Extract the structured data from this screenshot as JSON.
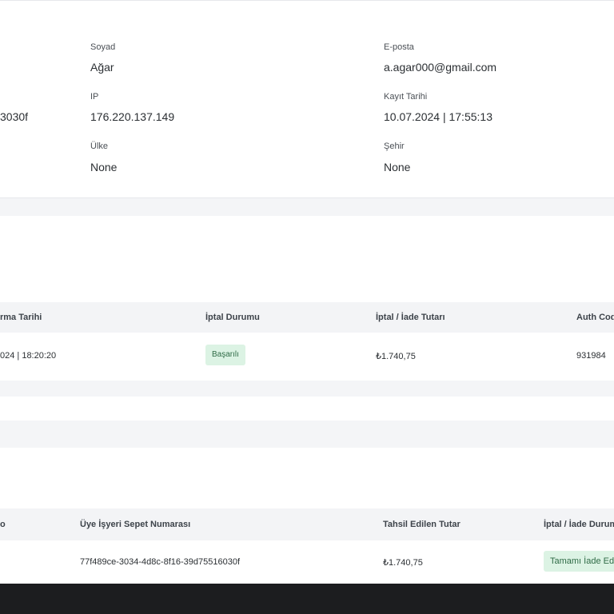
{
  "customer": {
    "surname_label": "Soyad",
    "surname_value": "Ağar",
    "email_label": "E-posta",
    "email_value": "a.agar000@gmail.com",
    "id_partial": "3030f",
    "ip_label": "IP",
    "ip_value": "176.220.137.149",
    "register_label": "Kayıt Tarihi",
    "register_value": "10.07.2024 | 17:55:13",
    "country_label": "Ülke",
    "country_value": "None",
    "city_label": "Şehir",
    "city_value": "None"
  },
  "cancel_table": {
    "headers": [
      "rma Tarihi",
      "İptal Durumu",
      "İptal / İade Tutarı",
      "Auth Cod"
    ],
    "row": {
      "date": "024 | 18:20:20",
      "status": "Başarılı",
      "amount": "₺1.740,75",
      "auth_code": "931984"
    }
  },
  "basket_table": {
    "headers": [
      "o",
      "Üye İşyeri Sepet Numarası",
      "Tahsil Edilen Tutar",
      "İptal / İade Durum"
    ],
    "row": {
      "basket_id": "77f489ce-3034-4d8c-8f16-39d75516030f",
      "amount": "₺1.740,75",
      "status": "Tamamı İade Ed"
    }
  },
  "colors": {
    "success_bg": "#dcf3e4",
    "success_text": "#2f6b46",
    "footer": "#1c1d1f"
  }
}
